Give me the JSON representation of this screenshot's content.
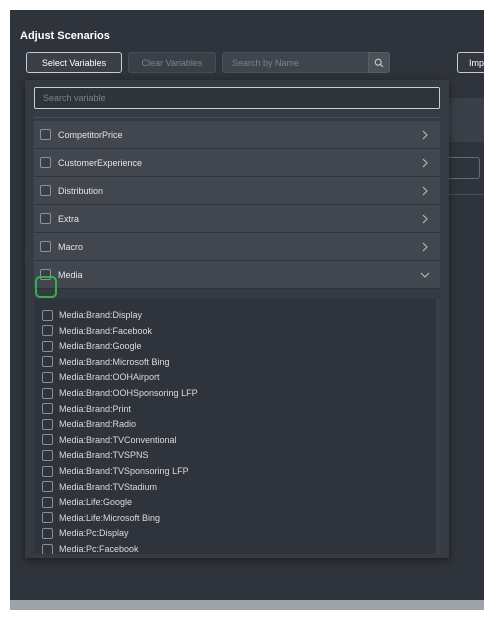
{
  "panel": {
    "title": "Adjust Scenarios"
  },
  "toolbar": {
    "select_variables_label": "Select Variables",
    "clear_variables_label": "Clear Variables",
    "search_placeholder": "Search by Name",
    "import_label": "Imp"
  },
  "dropdown": {
    "search_placeholder": "Search variable",
    "categories": [
      {
        "label": "CompetitorPrice",
        "expanded": false
      },
      {
        "label": "CustomerExperience",
        "expanded": false
      },
      {
        "label": "Distribution",
        "expanded": false
      },
      {
        "label": "Extra",
        "expanded": false
      },
      {
        "label": "Macro",
        "expanded": false
      },
      {
        "label": "Media",
        "expanded": true
      }
    ],
    "media_items": [
      "Media:Brand:Display",
      "Media:Brand:Facebook",
      "Media:Brand:Google",
      "Media:Brand:Microsoft Bing",
      "Media:Brand:OOHAirport",
      "Media:Brand:OOHSponsoring LFP",
      "Media:Brand:Print",
      "Media:Brand:Radio",
      "Media:Brand:TVConventional",
      "Media:Brand:TVSPNS",
      "Media:Brand:TVSponsoring LFP",
      "Media:Brand:TVStadium",
      "Media:Life:Google",
      "Media:Life:Microsoft Bing",
      "Media:Pc:Display",
      "Media:Pc:Facebook"
    ]
  },
  "background": {
    "stray_label": ":"
  },
  "colors": {
    "background": "#2f333b",
    "focus_ring": "#33b24a",
    "text": "#ffffff"
  },
  "icons": {
    "search": "search-icon",
    "collapsed": "chevron-right-icon",
    "expanded": "chevron-down-icon"
  }
}
